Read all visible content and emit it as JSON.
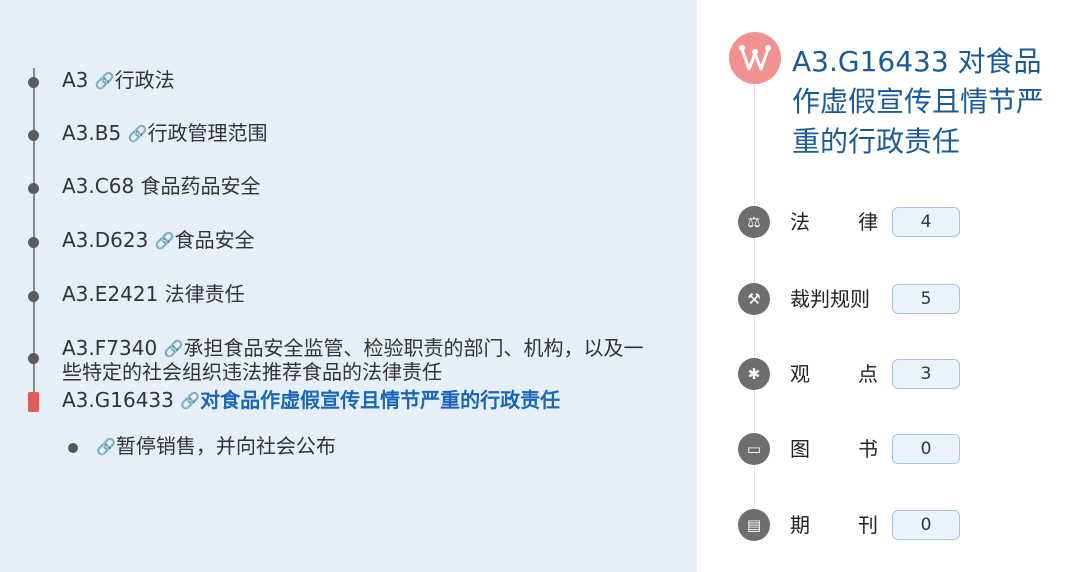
{
  "tree": {
    "items": [
      {
        "code": "A3",
        "link": "🔗",
        "label": "行政法"
      },
      {
        "code": "A3.B5",
        "link": "🔗",
        "label": "行政管理范围"
      },
      {
        "code": "A3.C68",
        "link": "",
        "label": "食品药品安全"
      },
      {
        "code": "A3.D623",
        "link": "🔗",
        "label": "食品安全"
      },
      {
        "code": "A3.E2421",
        "link": "",
        "label": "法律责任"
      },
      {
        "code": "A3.F7340",
        "link": "🔗",
        "label": "承担食品安全监管、检验职责的部门、机构，以及一些特定的社会组织违法推荐食品的法律责任"
      }
    ],
    "active": {
      "code": "A3.G16433",
      "link": "🔗",
      "label": "对食品作虚假宣传且情节严重的行政责任"
    },
    "child": {
      "link": "🔗",
      "label": "暂停销售，并向社会公布"
    }
  },
  "detail": {
    "title": "A3.G16433 对食品作虚假宣传且情节严重的行政责任",
    "stats": [
      {
        "icon": "scales-icon",
        "label_a": "法",
        "label_b": "律",
        "count": "4"
      },
      {
        "icon": "gavel-icon",
        "label": "裁判规则",
        "count": "5"
      },
      {
        "icon": "bulb-icon",
        "label_a": "观",
        "label_b": "点",
        "count": "3"
      },
      {
        "icon": "book-icon",
        "label_a": "图",
        "label_b": "书",
        "count": "0"
      },
      {
        "icon": "journal-icon",
        "label_a": "期",
        "label_b": "刊",
        "count": "0"
      }
    ]
  }
}
